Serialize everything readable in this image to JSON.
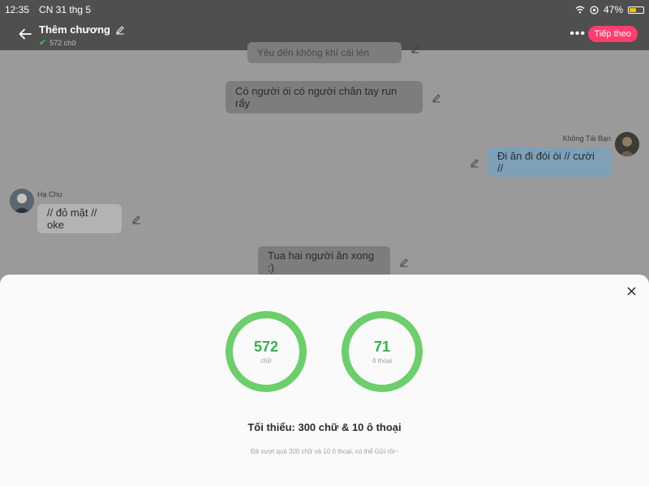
{
  "status_bar": {
    "time": "12:35",
    "date": "CN 31 thg 5",
    "battery": "47%"
  },
  "header": {
    "title": "Thêm chương",
    "word_count": "572 chữ",
    "next_label": "Tiếp theo"
  },
  "chat": {
    "partial_top": "Yêu đến không khí cái lén",
    "messages": [
      {
        "text": "Có người ói có người chân tay run rẩy",
        "align": "center"
      },
      {
        "text": "Đi ăn đi đói òi // cười  //",
        "align": "right",
        "sender": "Không Tái Bạn"
      },
      {
        "text": "// đỏ mặt // oke",
        "align": "left",
        "sender": "Hạ Chu"
      },
      {
        "text": "Tua hai người ăn xong :)",
        "align": "center"
      }
    ]
  },
  "sheet": {
    "words": {
      "value": "572",
      "unit": "chữ"
    },
    "dialogs": {
      "value": "71",
      "unit": "ô thoại"
    },
    "minimum": "Tối thiểu: 300 chữ & 10 ô thoại",
    "note": "Đã vượt quá 300 chữ và 10 ô thoại, có thể Gửi rồi~"
  },
  "colors": {
    "accent": "#ff3d6e",
    "ring": "#6bcf6b",
    "number": "#36b14a"
  }
}
